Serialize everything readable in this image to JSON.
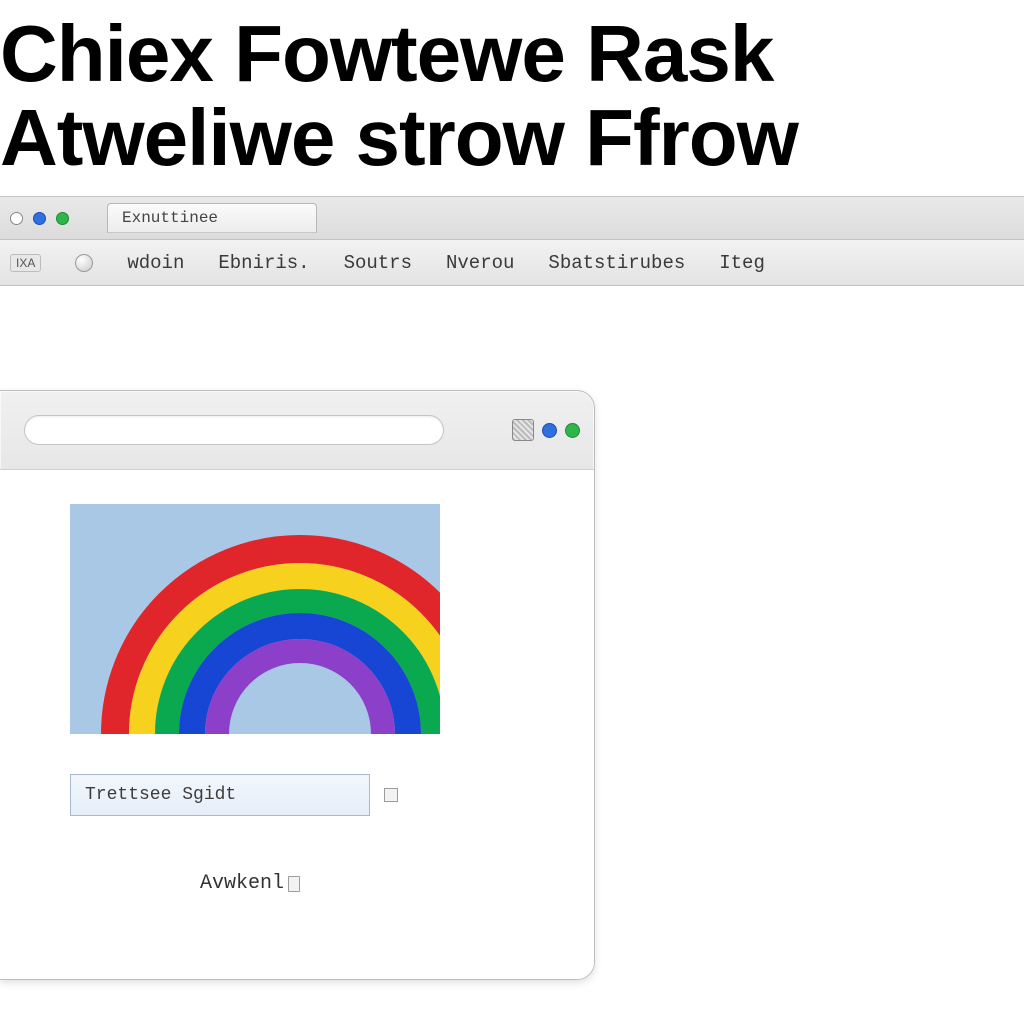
{
  "heading": {
    "line1": "Chiex Fowtewe Rask",
    "line2": "Atweliwe strow Ffrow"
  },
  "outer": {
    "tab_label": "Exnuttinee",
    "dots": [
      "dot-blank",
      "dot-blue",
      "dot-green"
    ],
    "menu_badge": "IXA",
    "menu_items": [
      "wdoin",
      "Ebniris.",
      "Soutrs",
      "Nverou",
      "Sbatstirubes",
      "Iteg"
    ]
  },
  "inner": {
    "right_dots": [
      "dot-blue",
      "dot-green"
    ],
    "input_value": "Trettsee  Sgidt",
    "bottom_label": "Avwkenl",
    "rainbow_colors": [
      "#e0262b",
      "#f6d21f",
      "#0aa84f",
      "#1746d4",
      "#8c3fc8"
    ],
    "sky_color": "#a9c8e6"
  }
}
